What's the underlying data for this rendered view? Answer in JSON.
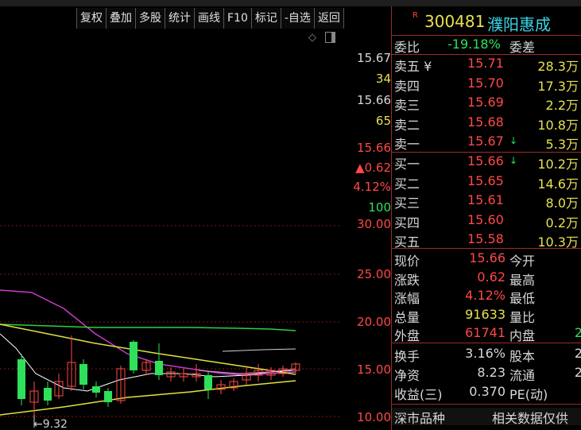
{
  "toolbar": [
    "复权",
    "叠加",
    "多股",
    "统计",
    "画线",
    "F10",
    "标记",
    "-自选",
    "返回"
  ],
  "price_axis": [
    {
      "t": "15.67",
      "c": "wht"
    },
    {
      "t": "34",
      "c": "yel"
    },
    {
      "t": "15.66",
      "c": "wht"
    },
    {
      "t": "65",
      "c": "yel"
    },
    {
      "t": "15.66",
      "c": "red"
    },
    {
      "t": "▲0.62",
      "c": "red"
    },
    {
      "t": "4.12%",
      "c": "red"
    },
    {
      "t": "100",
      "c": "grn"
    },
    {
      "t": "30.00",
      "c": "red"
    },
    {
      "t": "25.00",
      "c": "red"
    },
    {
      "t": "20.00",
      "c": "red"
    },
    {
      "t": "15.00",
      "c": "red"
    },
    {
      "t": "10.00",
      "c": "red"
    }
  ],
  "min_label": "←9.32",
  "quote": {
    "code": "300481",
    "name": "濮阳惠成",
    "r_mark": "R",
    "weibi_label": "委比",
    "weibi_value": "-19.18%",
    "weicha_label": "委差",
    "asks": [
      {
        "label": "卖五 ¥",
        "price": "15.71",
        "vol": "28.3万",
        "arrow": ""
      },
      {
        "label": "卖四",
        "price": "15.70",
        "vol": "17.3万",
        "arrow": ""
      },
      {
        "label": "卖三",
        "price": "15.69",
        "vol": "2.2万",
        "arrow": ""
      },
      {
        "label": "卖二",
        "price": "15.68",
        "vol": "10.8万",
        "arrow": ""
      },
      {
        "label": "卖一",
        "price": "15.67",
        "vol": "5.3万",
        "arrow": "↓"
      }
    ],
    "bids": [
      {
        "label": "买一",
        "price": "15.66",
        "vol": "10.2万",
        "arrow": "↓"
      },
      {
        "label": "买二",
        "price": "15.65",
        "vol": "14.6万",
        "arrow": ""
      },
      {
        "label": "买三",
        "price": "15.61",
        "vol": "8.0万",
        "arrow": ""
      },
      {
        "label": "买四",
        "price": "15.60",
        "vol": "0.2万",
        "arrow": ""
      },
      {
        "label": "买五",
        "price": "15.58",
        "vol": "10.3万",
        "arrow": ""
      }
    ],
    "stats": [
      {
        "l": "现价",
        "v": "15.66",
        "c": "red",
        "l2": "今开"
      },
      {
        "l": "涨跌",
        "v": "0.62",
        "c": "red",
        "l2": "最高"
      },
      {
        "l": "涨幅",
        "v": "4.12%",
        "c": "red",
        "l2": "最低"
      },
      {
        "l": "总量",
        "v": "91633",
        "c": "yel",
        "l2": "量比"
      },
      {
        "l": "外盘",
        "v": "61741",
        "c": "red",
        "l2": "内盘",
        "v2": "2",
        "c2": "grn"
      }
    ],
    "stats2": [
      {
        "l": "换手",
        "v": "3.16%",
        "l2": "股本",
        "v2": "2"
      },
      {
        "l": "净资",
        "v": "8.23",
        "l2": "流通",
        "v2": "2"
      },
      {
        "l": "收益(三)",
        "v": "0.370",
        "l2": "PE(动)",
        "v2": ""
      }
    ],
    "bottom_left": "深市品种",
    "bottom_right": "相关数据仅供"
  }
}
